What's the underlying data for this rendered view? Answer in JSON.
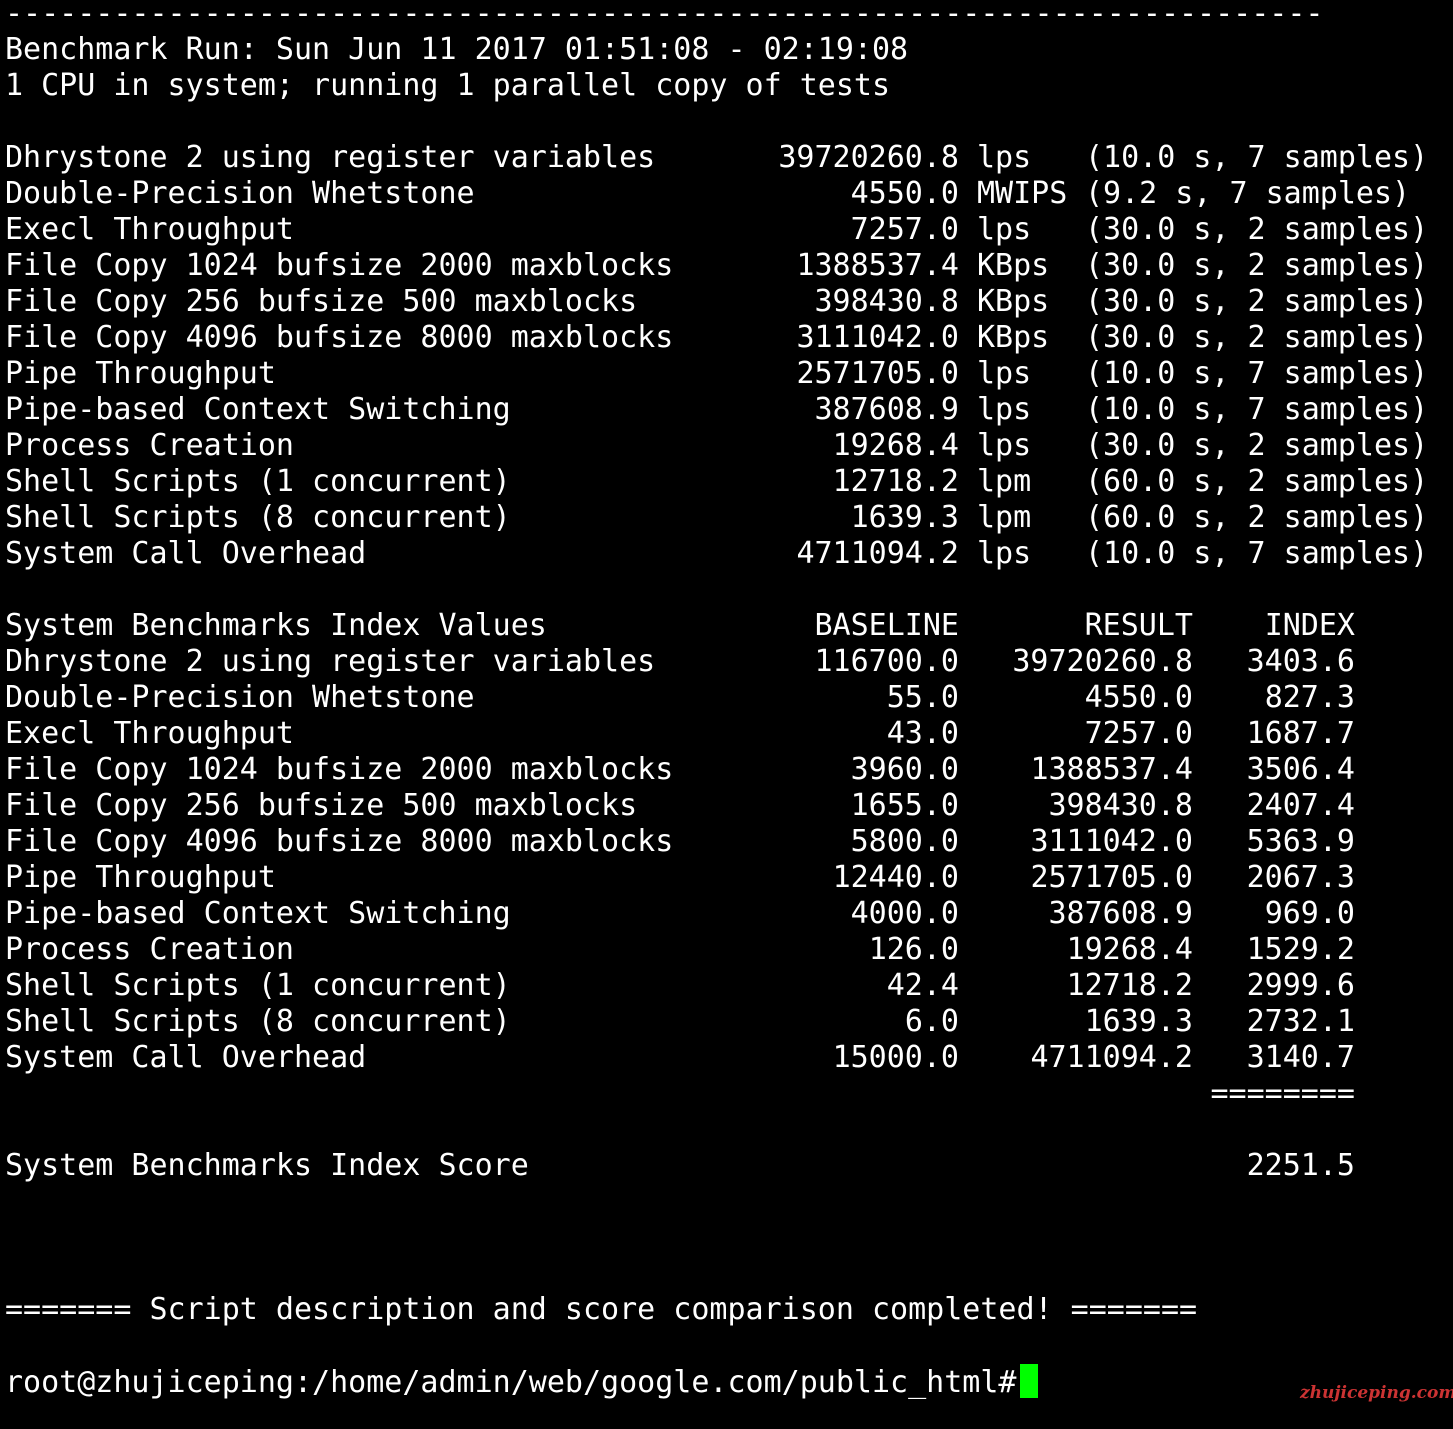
{
  "colors": {
    "background": "#000000",
    "foreground": "#ffffff",
    "cursor": "#00ff00",
    "watermark": "#cc3333"
  },
  "top_rule": "-------------------------------------------------------------------------",
  "header": {
    "run_line": "Benchmark Run: Sun Jun 11 2017 01:51:08 - 02:19:08",
    "cpu_line": "1 CPU in system; running 1 parallel copy of tests"
  },
  "results": [
    {
      "name": "Dhrystone 2 using register variables",
      "value": "39720260.8",
      "unit": "lps",
      "info": "(10.0 s, 7 samples)"
    },
    {
      "name": "Double-Precision Whetstone",
      "value": "4550.0",
      "unit": "MWIPS",
      "info": "(9.2 s, 7 samples)"
    },
    {
      "name": "Execl Throughput",
      "value": "7257.0",
      "unit": "lps",
      "info": "(30.0 s, 2 samples)"
    },
    {
      "name": "File Copy 1024 bufsize 2000 maxblocks",
      "value": "1388537.4",
      "unit": "KBps",
      "info": "(30.0 s, 2 samples)"
    },
    {
      "name": "File Copy 256 bufsize 500 maxblocks",
      "value": "398430.8",
      "unit": "KBps",
      "info": "(30.0 s, 2 samples)"
    },
    {
      "name": "File Copy 4096 bufsize 8000 maxblocks",
      "value": "3111042.0",
      "unit": "KBps",
      "info": "(30.0 s, 2 samples)"
    },
    {
      "name": "Pipe Throughput",
      "value": "2571705.0",
      "unit": "lps",
      "info": "(10.0 s, 7 samples)"
    },
    {
      "name": "Pipe-based Context Switching",
      "value": "387608.9",
      "unit": "lps",
      "info": "(10.0 s, 7 samples)"
    },
    {
      "name": "Process Creation",
      "value": "19268.4",
      "unit": "lps",
      "info": "(30.0 s, 2 samples)"
    },
    {
      "name": "Shell Scripts (1 concurrent)",
      "value": "12718.2",
      "unit": "lpm",
      "info": "(60.0 s, 2 samples)"
    },
    {
      "name": "Shell Scripts (8 concurrent)",
      "value": "1639.3",
      "unit": "lpm",
      "info": "(60.0 s, 2 samples)"
    },
    {
      "name": "System Call Overhead",
      "value": "4711094.2",
      "unit": "lps",
      "info": "(10.0 s, 7 samples)"
    }
  ],
  "index_table": {
    "title": "System Benchmarks Index Values",
    "headers": {
      "baseline": "BASELINE",
      "result": "RESULT",
      "index": "INDEX"
    },
    "rows": [
      {
        "name": "Dhrystone 2 using register variables",
        "baseline": "116700.0",
        "result": "39720260.8",
        "index": "3403.6"
      },
      {
        "name": "Double-Precision Whetstone",
        "baseline": "55.0",
        "result": "4550.0",
        "index": "827.3"
      },
      {
        "name": "Execl Throughput",
        "baseline": "43.0",
        "result": "7257.0",
        "index": "1687.7"
      },
      {
        "name": "File Copy 1024 bufsize 2000 maxblocks",
        "baseline": "3960.0",
        "result": "1388537.4",
        "index": "3506.4"
      },
      {
        "name": "File Copy 256 bufsize 500 maxblocks",
        "baseline": "1655.0",
        "result": "398430.8",
        "index": "2407.4"
      },
      {
        "name": "File Copy 4096 bufsize 8000 maxblocks",
        "baseline": "5800.0",
        "result": "3111042.0",
        "index": "5363.9"
      },
      {
        "name": "Pipe Throughput",
        "baseline": "12440.0",
        "result": "2571705.0",
        "index": "2067.3"
      },
      {
        "name": "Pipe-based Context Switching",
        "baseline": "4000.0",
        "result": "387608.9",
        "index": "969.0"
      },
      {
        "name": "Process Creation",
        "baseline": "126.0",
        "result": "19268.4",
        "index": "1529.2"
      },
      {
        "name": "Shell Scripts (1 concurrent)",
        "baseline": "42.4",
        "result": "12718.2",
        "index": "2999.6"
      },
      {
        "name": "Shell Scripts (8 concurrent)",
        "baseline": "6.0",
        "result": "1639.3",
        "index": "2732.1"
      },
      {
        "name": "System Call Overhead",
        "baseline": "15000.0",
        "result": "4711094.2",
        "index": "3140.7"
      }
    ],
    "separator": "========",
    "score_label": "System Benchmarks Index Score",
    "score_value": "2251.5"
  },
  "completion_message": "======= Script description and score comparison completed! =======",
  "prompt": "root@zhujiceping:/home/admin/web/google.com/public_html#",
  "watermark": "zhujiceping.com"
}
